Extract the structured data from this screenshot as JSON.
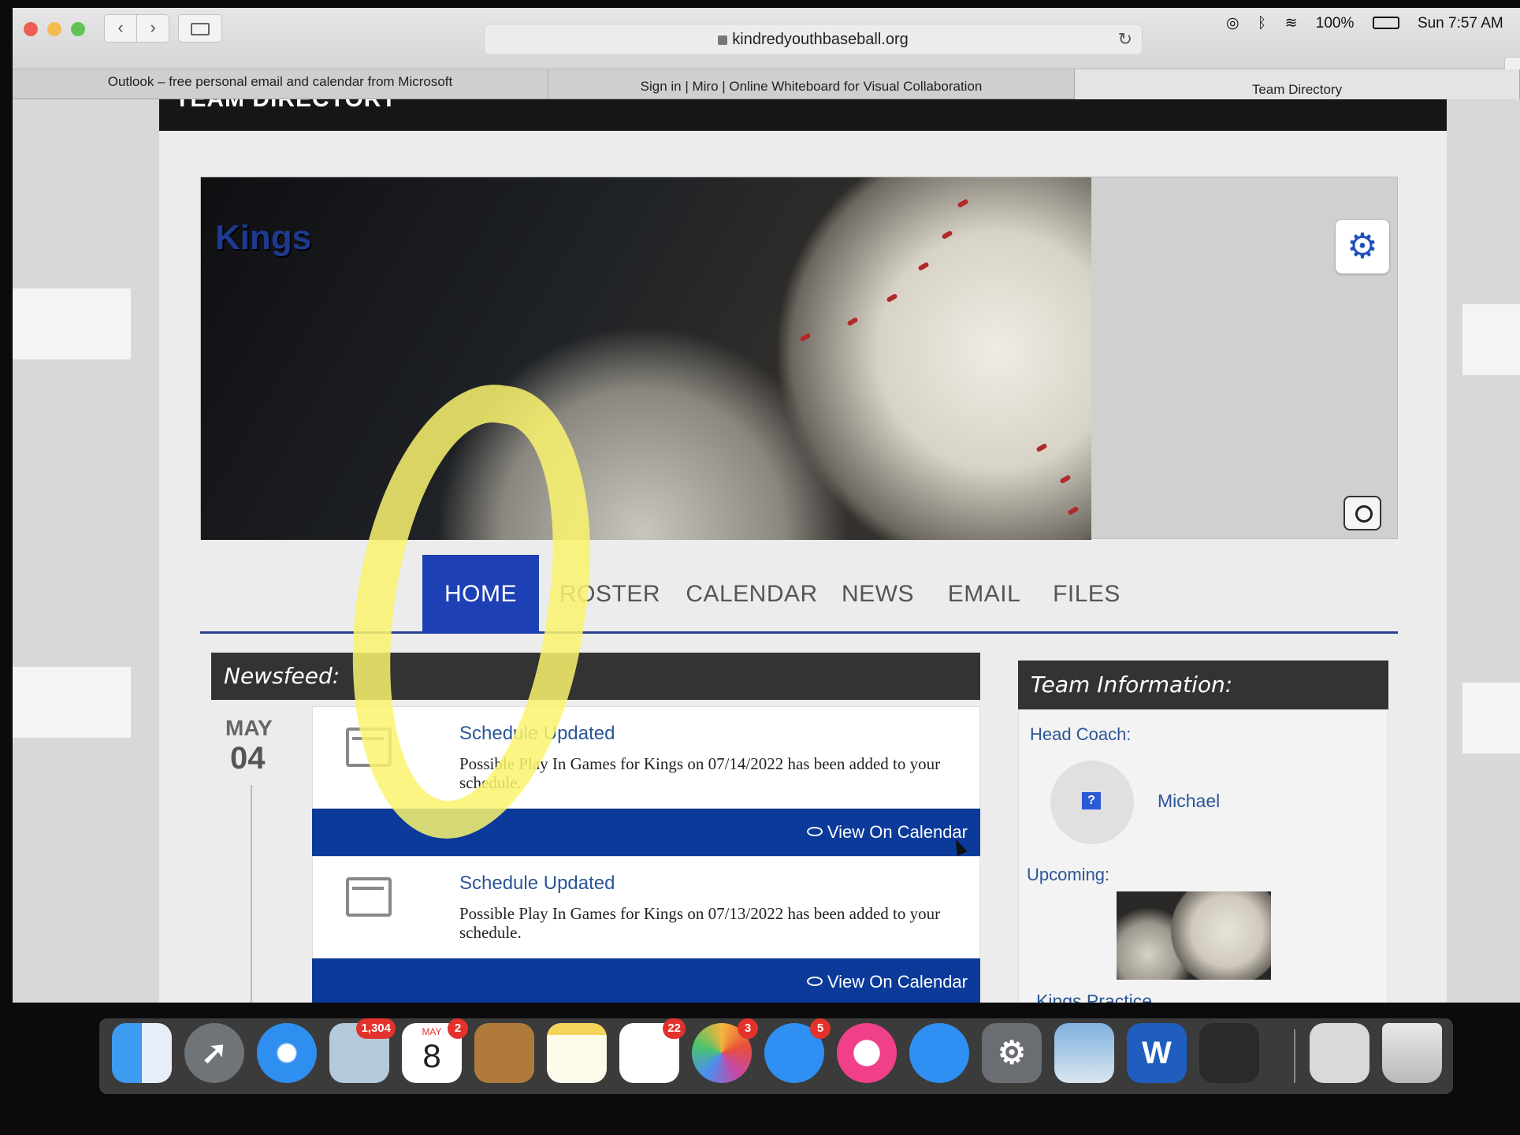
{
  "browser": {
    "url": "kindredyouthbaseball.org",
    "tabs": [
      {
        "label": "Outlook – free personal email and calendar from Microsoft"
      },
      {
        "label": "Sign in | Miro | Online Whiteboard for Visual Collaboration"
      },
      {
        "label": "Team Directory"
      }
    ],
    "status": {
      "battery": "100%",
      "clock": "Sun 7:57 AM"
    }
  },
  "page": {
    "section_title": "TEAM DIRECTORY",
    "team_name": "Kings",
    "nav": [
      "HOME",
      "ROSTER",
      "CALENDAR",
      "NEWS",
      "EMAIL",
      "FILES"
    ],
    "active_nav": "HOME"
  },
  "newsfeed": {
    "header": "Newsfeed:",
    "date": {
      "month": "MAY",
      "day": "04"
    },
    "items": [
      {
        "title": "Schedule Updated",
        "body": "Possible Play In Games for Kings on 07/14/2022 has been added to your schedule.",
        "action": "View On Calendar"
      },
      {
        "title": "Schedule Updated",
        "body": "Possible Play In Games for Kings on 07/13/2022 has been added to your schedule.",
        "action": "View On Calendar"
      }
    ]
  },
  "team_info": {
    "header": "Team Information:",
    "head_coach_label": "Head Coach:",
    "coach_avatar_placeholder": "?",
    "coach_name": "Michael",
    "upcoming_label": "Upcoming:",
    "upcoming_event": "Kings Practice"
  },
  "dock": {
    "badges": {
      "mail": "1,304",
      "calendar": "2",
      "reminders": "22",
      "photos": "3",
      "messages": "5"
    },
    "calendar_month": "MAY",
    "calendar_day": "8",
    "word_letter": "W"
  },
  "colors": {
    "accent_blue": "#1e40b5",
    "bar_blue": "#0b3a9a",
    "link_blue": "#2b5597",
    "highlight": "#f7f26a"
  }
}
